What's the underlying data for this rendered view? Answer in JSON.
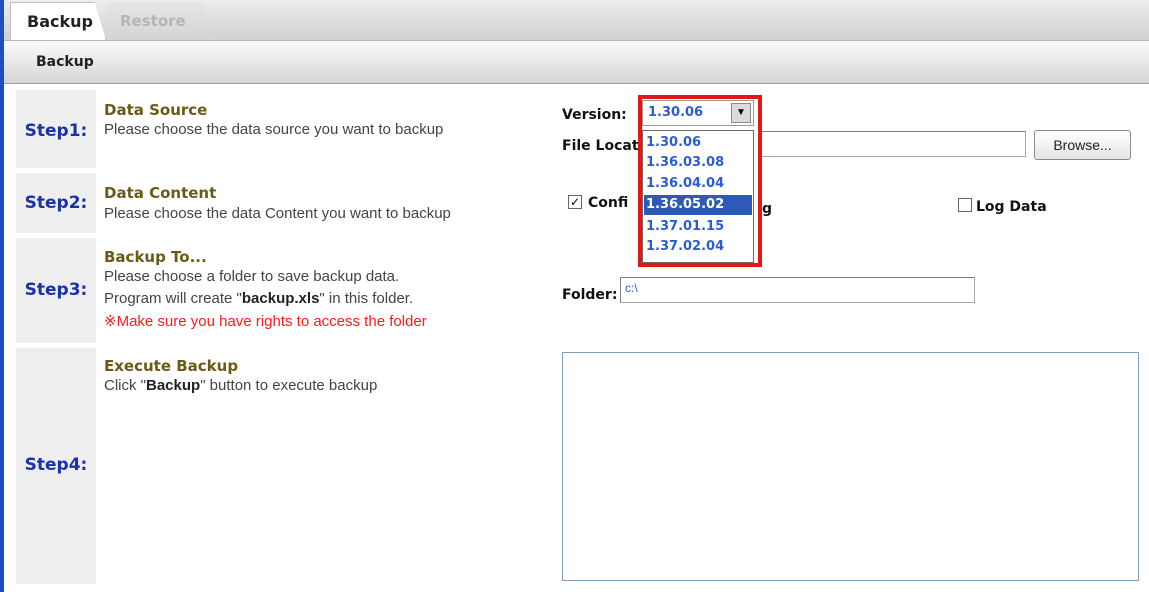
{
  "tabs": [
    {
      "label": "Backup",
      "active": true
    },
    {
      "label": "Restore",
      "active": false
    }
  ],
  "subheader": {
    "label": "Backup"
  },
  "steps": [
    {
      "label": "Step1:",
      "title": "Data Source",
      "desc": "Please choose the data source you want to backup"
    },
    {
      "label": "Step2:",
      "title": "Data Content",
      "desc": "Please choose the data Content you want to backup"
    },
    {
      "label": "Step3:",
      "title": "Backup To...",
      "desc_line1": "Please choose a folder to save backup data.",
      "desc_line2_pre": "Program will create \"",
      "desc_line2_bold": "backup.xls",
      "desc_line2_post": "\" in this folder.",
      "warning": "※Make sure you have rights to access the folder"
    },
    {
      "label": "Step4:",
      "title": "Execute Backup",
      "desc_pre": "Click \"",
      "desc_bold": "Backup",
      "desc_post": "\" button to execute backup"
    }
  ],
  "version": {
    "label": "Version:",
    "selected": "1.30.06",
    "options": [
      "1.30.06",
      "1.36.03.08",
      "1.36.04.04",
      "1.36.05.02",
      "1.37.01.15",
      "1.37.02.04"
    ],
    "highlighted": "1.36.05.02"
  },
  "file_location": {
    "label_visible": "File Locat",
    "value": ""
  },
  "browse_button": {
    "label": "Browse..."
  },
  "content_options": {
    "config": {
      "label_left": "Confi",
      "label_right": "g",
      "checked": true
    },
    "log": {
      "label": "Log Data",
      "checked": false
    }
  },
  "folder": {
    "label": "Folder:",
    "value": "c:\\"
  },
  "colors": {
    "accent": "#1f4fbf",
    "step_label": "#1a32a8",
    "title": "#6b5a16",
    "warning": "#ff1a1a",
    "highlight_border": "#e21818",
    "dropdown_selected_bg": "#2e59b8",
    "option_text": "#2b5bd6"
  }
}
